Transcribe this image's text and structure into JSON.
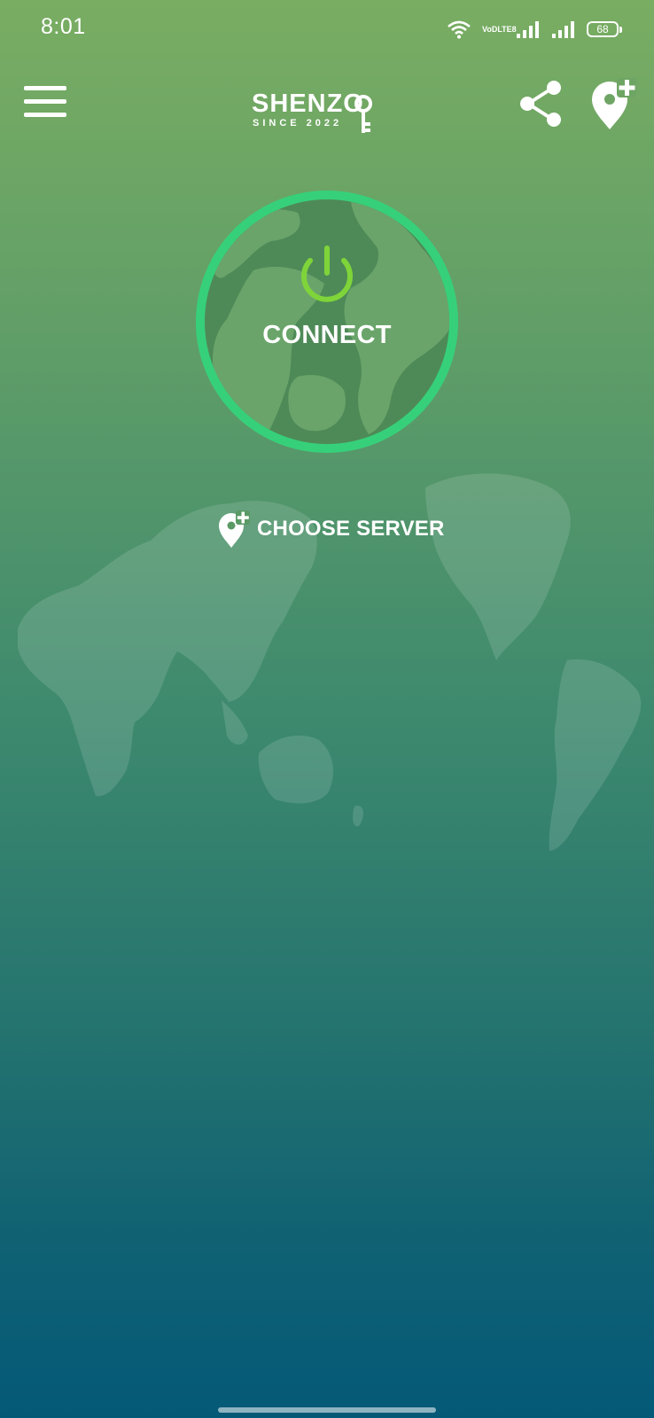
{
  "status_bar": {
    "time": "8:01",
    "network_label_top": "VoD",
    "network_label_bottom": "LTE8",
    "battery_level": "68"
  },
  "header": {
    "logo_text": "SHENZO",
    "logo_subtext": "SINCE 2022"
  },
  "main": {
    "connect_label": "CONNECT",
    "choose_server_label": "CHOOSE SERVER"
  },
  "icons": {
    "menu": "hamburger-menu-icon",
    "share": "share-icon",
    "add_location": "add-location-pin-icon",
    "power": "power-icon",
    "globe": "globe-icon"
  },
  "colors": {
    "ring_accent": "#37d07a",
    "power_icon": "#7fd43a",
    "globe_fill": "#4e8a57",
    "globe_land": "#6aa46a",
    "gradient_top": "#79ad62",
    "gradient_bottom": "#045977"
  }
}
